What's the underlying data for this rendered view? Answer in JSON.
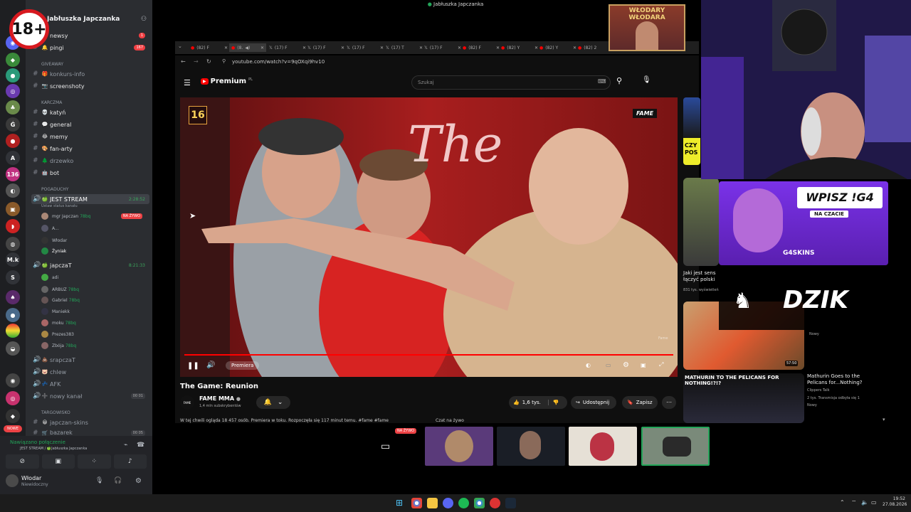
{
  "window_title": "Jabłuszka Japczanka",
  "server": {
    "name": "Jabłuszka Japczanka",
    "status_text": "Ustaw status kanału"
  },
  "channels": [
    {
      "emoji": "📰",
      "name": "newsy",
      "badge": "1"
    },
    {
      "emoji": "🔔",
      "name": "pingi",
      "badge": "167"
    }
  ],
  "categories": [
    "GIVEAWAY",
    "KARCZMA",
    "POGADUCHY",
    "TARGOWISKO"
  ],
  "giveaway": [
    {
      "emoji": "🎁",
      "name": "konkurs-info"
    },
    {
      "emoji": "📷",
      "name": "screenshoty"
    }
  ],
  "karczma": [
    {
      "emoji": "💀",
      "name": "katyń"
    },
    {
      "emoji": "💬",
      "name": "general"
    },
    {
      "emoji": "😂",
      "name": "memy"
    },
    {
      "emoji": "🎨",
      "name": "fan-arty"
    },
    {
      "emoji": "🌲",
      "name": "drzewko"
    },
    {
      "emoji": "🤖",
      "name": "bot"
    }
  ],
  "voice": [
    {
      "name": "JEST STREAM",
      "time": "2:28:52",
      "users": [
        {
          "name": "mgr Japczan",
          "tag": "78bq",
          "live": "NA ŻYWO"
        },
        {
          "name": "A...",
          "tag": "",
          "live": ""
        },
        {
          "name": "Włodar",
          "tag": "",
          "live": ""
        },
        {
          "name": "Żyniak",
          "tag": "",
          "live": ""
        }
      ]
    },
    {
      "name": "japczaT",
      "time": "8:21:33",
      "users": [
        {
          "name": "adi",
          "tag": "",
          "live": ""
        },
        {
          "name": "ARBUZ",
          "tag": "78bq",
          "live": ""
        },
        {
          "name": "Gabriel",
          "tag": "78bq",
          "live": ""
        },
        {
          "name": "Maniekk",
          "tag": "",
          "live": ""
        },
        {
          "name": "moku",
          "tag": "78bq",
          "live": ""
        },
        {
          "name": "Prezes383",
          "tag": "",
          "live": ""
        },
        {
          "name": "Zbója",
          "tag": "78bq",
          "live": ""
        }
      ]
    }
  ],
  "more_voice": [
    {
      "name": "srapczaT"
    },
    {
      "name": "chlew"
    },
    {
      "name": "AFK"
    },
    {
      "name": "nowy kanał",
      "count": "00",
      "count2": "01"
    }
  ],
  "targowisko": [
    {
      "name": "japczan-skins"
    },
    {
      "name": "bazarek",
      "count": "00",
      "count2": "05"
    }
  ],
  "connection": {
    "title": "Nawiązano połączenie",
    "subtitle": "JEST STREAM / 🍏Jabłuszka Japczanka"
  },
  "user": {
    "name": "Włodar",
    "status": "Niewidoczny"
  },
  "browser": {
    "tabs": [
      "(82) F",
      "(8.",
      "(17) F",
      "(17) F",
      "(17) F",
      "(17) T",
      "(17) F",
      "(82) F",
      "(82) Y",
      "(82) Y",
      "(82) 2"
    ],
    "url": "youtube.com/watch?v=9qOXqi9hv10"
  },
  "youtube": {
    "logo": "Premium",
    "logo_sup": "PL",
    "search_placeholder": "Szukaj",
    "video": {
      "title": "The Game: Reunion",
      "age": "16",
      "channel": "FAME MMA",
      "subs": "1,4 mln subskrybentów",
      "premiere": "Premiera",
      "likes": "1,6 tys.",
      "share": "Udostępnij",
      "save": "Zapisz",
      "brand": "FAME",
      "slogan": "The",
      "description": "W tej chwili ogląda 18 457 osób. Premiera w toku. Rozpoczęła się 117 minut temu. #fame #fame",
      "chat": "Czat na żywo",
      "caption": "Fame"
    },
    "related": [
      {
        "title": "Jaki jest sens łączyć polski",
        "meta": "831 tys. wyświetleń"
      },
      {
        "title": "Mathurin Goes to the Pelicans for...Nothing?",
        "channel": "Clippers Talk",
        "meta": "2 tys. Transmisja odbyła się 1",
        "badge": "Nowy",
        "duration": "57:50",
        "thumb_text": "MATHURIN TO THE PELICANS FOR NOTHING!?!?"
      },
      {
        "title": "",
        "meta": "Nowy"
      }
    ],
    "thumb_side": "CZY POS"
  },
  "overlays": {
    "age_badge": "18+",
    "wlodary": "WŁODARY WŁODARA",
    "wpisz": "WPISZ !G4",
    "na_czacie": "NA CZACIE",
    "g4skins": "G4SKINS",
    "dzik": "DZIK"
  },
  "streams": {
    "live_label": "NA ŻYWO"
  },
  "taskbar": {
    "time": "19:52",
    "date": "27.08.2026"
  }
}
